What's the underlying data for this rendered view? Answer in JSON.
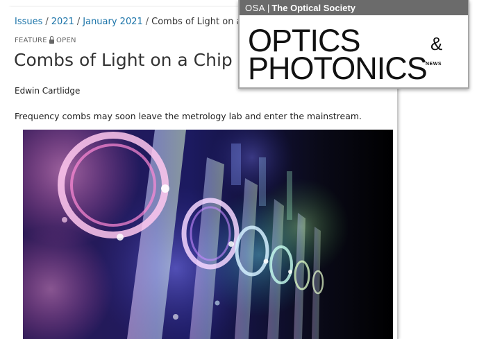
{
  "breadcrumb": {
    "issues": "Issues",
    "year": "2021",
    "issue": "January 2021",
    "current": "Combs of Light on a Chip",
    "separator": "/"
  },
  "article": {
    "section": "FEATURE",
    "access": "OPEN",
    "title": "Combs of Light on a Chip",
    "author": "Edwin Cartlidge",
    "lede": "Frequency combs may soon leave the metrology lab and enter the mainstream."
  },
  "masthead": {
    "org_abbrev": "OSA",
    "org_divider": "|",
    "org_name": "The Optical Society",
    "logo_line1": "OPTICS",
    "logo_amp": "&",
    "logo_line2": "PHOTONICS",
    "logo_news": "NEWS"
  },
  "colors": {
    "link": "#1a73a8",
    "masthead_bar": "#6b6b6b",
    "hero_background": "#000000"
  }
}
